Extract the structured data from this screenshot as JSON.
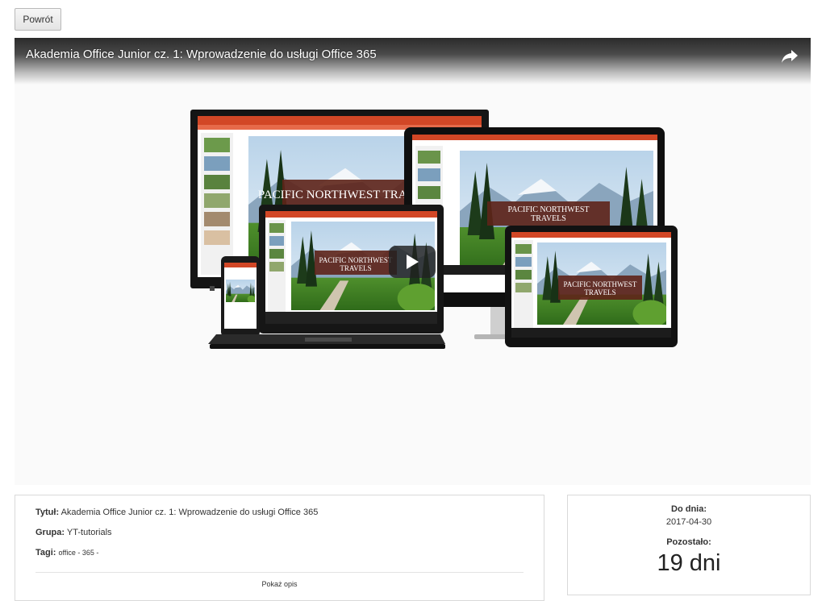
{
  "back_button": {
    "label": "Powrót"
  },
  "video": {
    "title": "Akademia Office Junior cz. 1: Wprowadzenie do usługi Office 365",
    "thumbnail_banner_text": "PACIFIC NORTHWEST TRAVELS",
    "icons": {
      "share": "share-icon",
      "play": "play-icon"
    }
  },
  "details": {
    "title_label": "Tytuł:",
    "title_value": "Akademia Office Junior cz. 1: Wprowadzenie do usługi Office 365",
    "group_label": "Grupa:",
    "group_value": "YT-tutorials",
    "tags_label": "Tagi:",
    "tags_value": "office - 365 -",
    "show_description": "Pokaż opis"
  },
  "deadline": {
    "until_label": "Do dnia:",
    "until_value": "2017-04-30",
    "remaining_label": "Pozostało:",
    "remaining_value": "19 dni"
  },
  "colors": {
    "office_accent": "#d24726",
    "play_button": "#212121"
  }
}
